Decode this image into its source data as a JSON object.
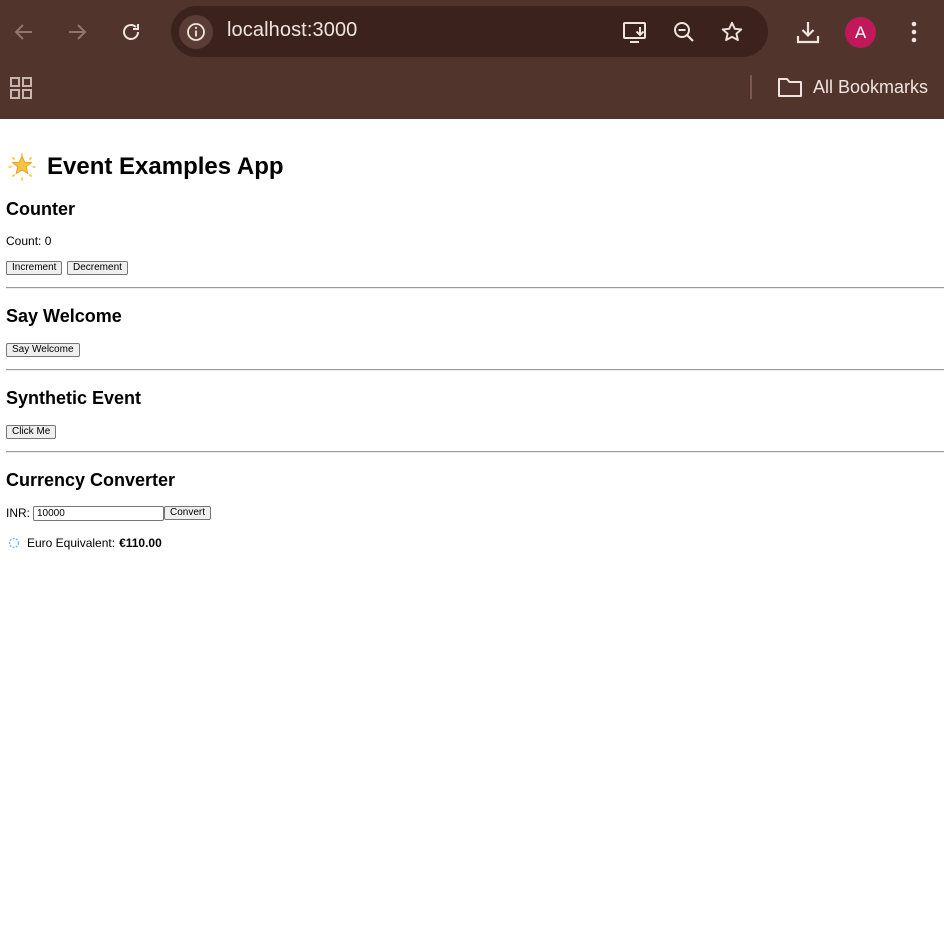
{
  "browser": {
    "url": "localhost:3000",
    "profile_initial": "A",
    "bookmarks_label": "All Bookmarks",
    "colors": {
      "frame": "#51342b",
      "omnibox": "#3b221c",
      "avatar": "#c2185b"
    }
  },
  "app": {
    "title": "Event Examples App",
    "title_icon": "glowing-star-icon",
    "counter": {
      "heading": "Counter",
      "count_label": "Count: 0",
      "increment_label": "Increment",
      "decrement_label": "Decrement"
    },
    "welcome": {
      "heading": "Say Welcome",
      "button_label": "Say Welcome"
    },
    "synthetic": {
      "heading": "Synthetic Event",
      "button_label": "Click Me"
    },
    "converter": {
      "heading": "Currency Converter",
      "input_label": "INR:",
      "input_value": "10000",
      "convert_label": "Convert",
      "result_label": "Euro Equivalent:",
      "result_value": "€110.00",
      "result_icon": "loading-spinner-icon"
    }
  }
}
